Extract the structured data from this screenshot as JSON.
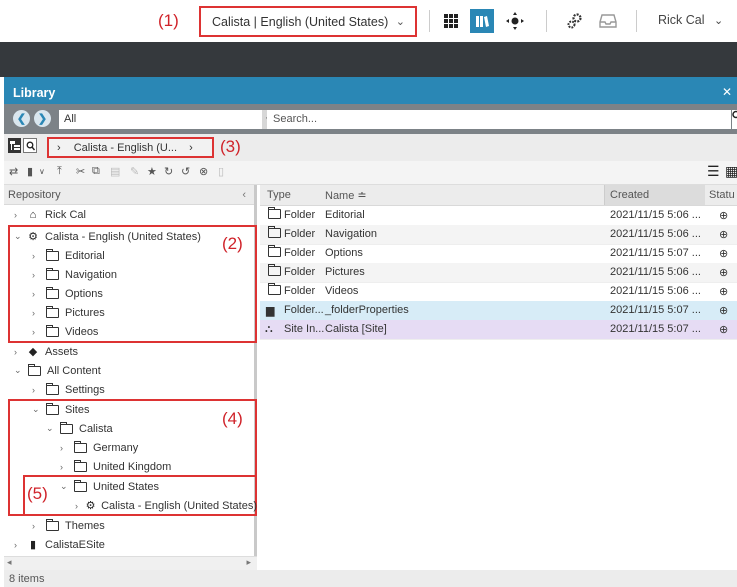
{
  "annotations": [
    "(1)",
    "(2)",
    "(3)",
    "(4)",
    "(5)"
  ],
  "topbar": {
    "site_selector": "Calista | English (United States)",
    "user": "Rick Cal",
    "icons": [
      "apps-grid-icon",
      "library-icon",
      "target-icon",
      "gears-icon",
      "inbox-icon"
    ]
  },
  "library": {
    "title": "Library",
    "scope_value": "All",
    "search_placeholder": "Search...",
    "breadcrumb": "Calista - English (U...",
    "repository_header": "Repository",
    "tree": [
      {
        "label": "Rick Cal",
        "icon": "home-icon"
      },
      {
        "label": "Calista - English (United States)",
        "icon": "site-icon"
      },
      {
        "label": "Editorial",
        "icon": "folder-icon"
      },
      {
        "label": "Navigation",
        "icon": "folder-icon"
      },
      {
        "label": "Options",
        "icon": "folder-icon"
      },
      {
        "label": "Pictures",
        "icon": "folder-icon"
      },
      {
        "label": "Videos",
        "icon": "folder-icon"
      },
      {
        "label": "Assets",
        "icon": "assets-icon"
      },
      {
        "label": "All Content",
        "icon": "folder-icon"
      },
      {
        "label": "Settings",
        "icon": "folder-icon"
      },
      {
        "label": "Sites",
        "icon": "folder-icon"
      },
      {
        "label": "Calista",
        "icon": "folder-icon"
      },
      {
        "label": "Germany",
        "icon": "folder-icon"
      },
      {
        "label": "United Kingdom",
        "icon": "folder-icon"
      },
      {
        "label": "United States",
        "icon": "folder-icon"
      },
      {
        "label": "Calista - English (United States)",
        "icon": "site-icon"
      },
      {
        "label": "Themes",
        "icon": "folder-icon"
      },
      {
        "label": "CalistaESite",
        "icon": "document-icon"
      }
    ],
    "columns": [
      "Type",
      "Name",
      "Created",
      "Status"
    ],
    "column_header_labels": {
      "type": "Type",
      "name": "Name ≐",
      "created": "Created",
      "status": "Statu"
    },
    "rows": [
      {
        "type": "Folder",
        "name": "Editorial",
        "created": "2021/11/15 5:06 ..."
      },
      {
        "type": "Folder",
        "name": "Navigation",
        "created": "2021/11/15 5:06 ..."
      },
      {
        "type": "Folder",
        "name": "Options",
        "created": "2021/11/15 5:07 ..."
      },
      {
        "type": "Folder",
        "name": "Pictures",
        "created": "2021/11/15 5:06 ..."
      },
      {
        "type": "Folder",
        "name": "Videos",
        "created": "2021/11/15 5:06 ..."
      },
      {
        "type": "Folder...",
        "name": "_folderProperties",
        "created": "2021/11/15 5:07 ..."
      },
      {
        "type": "Site In...",
        "name": "Calista [Site]",
        "created": "2021/11/15 5:07 ..."
      }
    ],
    "status_text": "8 items"
  },
  "colors": {
    "accent": "#2a87b5",
    "annotation_red": "#d0232a",
    "row_blue": "#d7ecf7",
    "row_purple": "#e6dcf4",
    "dark_band": "#35393d"
  }
}
